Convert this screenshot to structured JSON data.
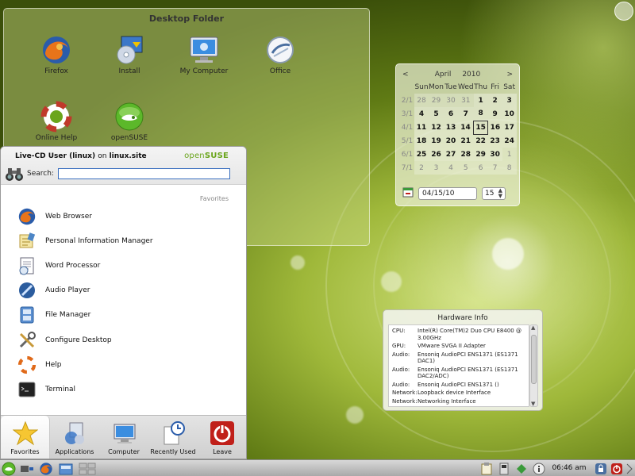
{
  "desktop_folder": {
    "title": "Desktop Folder",
    "icons": [
      {
        "label": "Firefox",
        "icon": "firefox-icon"
      },
      {
        "label": "Install",
        "icon": "install-icon"
      },
      {
        "label": "My Computer",
        "icon": "computer-icon"
      },
      {
        "label": "Office",
        "icon": "office-icon"
      },
      {
        "label": "Online Help",
        "icon": "lifebuoy-icon"
      },
      {
        "label": "openSUSE",
        "icon": "opensuse-icon"
      }
    ]
  },
  "calendar": {
    "prev": "<",
    "next": ">",
    "month": "April",
    "year": "2010",
    "weekdays": [
      "Sun",
      "Mon",
      "Tue",
      "Wed",
      "Thu",
      "Fri",
      "Sat"
    ],
    "weeks": [
      {
        "wk": "2/1",
        "days": [
          "28",
          "29",
          "30",
          "31",
          "1",
          "2",
          "3"
        ]
      },
      {
        "wk": "3/1",
        "days": [
          "4",
          "5",
          "6",
          "7",
          "8",
          "9",
          "10"
        ]
      },
      {
        "wk": "4/1",
        "days": [
          "11",
          "12",
          "13",
          "14",
          "15",
          "16",
          "17"
        ]
      },
      {
        "wk": "5/1",
        "days": [
          "18",
          "19",
          "20",
          "21",
          "22",
          "23",
          "24"
        ]
      },
      {
        "wk": "6/1",
        "days": [
          "25",
          "26",
          "27",
          "28",
          "29",
          "30",
          "1"
        ]
      },
      {
        "wk": "7/1",
        "days": [
          "2",
          "3",
          "4",
          "5",
          "6",
          "7",
          "8"
        ]
      }
    ],
    "date_value": "04/15/10",
    "week_value": "15"
  },
  "hardware_info": {
    "title": "Hardware Info",
    "rows": [
      {
        "key": "CPU:",
        "value": "Intel(R) Core(TM)2 Duo CPU E8400 @ 3.00GHz"
      },
      {
        "key": "GPU:",
        "value": "VMware SVGA II Adapter"
      },
      {
        "key": "Audio:",
        "value": "Ensoniq AudioPCI ENS1371 (ES1371 DAC1)"
      },
      {
        "key": "Audio:",
        "value": "Ensoniq AudioPCI ENS1371 (ES1371 DAC2/ADC)"
      },
      {
        "key": "Audio:",
        "value": "Ensoniq AudioPCI ENS1371 ()"
      },
      {
        "key": "Network:",
        "value": "Loopback device Interface"
      },
      {
        "key": "Network:",
        "value": "Networking Interface"
      }
    ]
  },
  "kickoff": {
    "user": "Live-CD User (linux)",
    "on": "on",
    "host": "linux.site",
    "brand_open": "open",
    "brand_suse": "SUSE",
    "search_label": "Search:",
    "search_value": "",
    "favorites_label": "Favorites",
    "items": [
      {
        "label": "Web Browser",
        "icon": "firefox-icon"
      },
      {
        "label": "Personal Information Manager",
        "icon": "pim-icon"
      },
      {
        "label": "Word Processor",
        "icon": "word-processor-icon"
      },
      {
        "label": "Audio Player",
        "icon": "audio-player-icon"
      },
      {
        "label": "File Manager",
        "icon": "file-manager-icon"
      },
      {
        "label": "Configure Desktop",
        "icon": "tools-icon"
      },
      {
        "label": "Help",
        "icon": "lifebuoy-icon"
      },
      {
        "label": "Terminal",
        "icon": "terminal-icon"
      }
    ],
    "tabs": [
      {
        "label": "Favorites",
        "icon": "star-icon"
      },
      {
        "label": "Applications",
        "icon": "applications-icon"
      },
      {
        "label": "Computer",
        "icon": "computer-icon"
      },
      {
        "label": "Recently Used",
        "icon": "clock-icon"
      },
      {
        "label": "Leave",
        "icon": "power-icon"
      }
    ]
  },
  "taskbar": {
    "clock": "06:46 am"
  },
  "colors": {
    "accent_green": "#6aa51b",
    "search_border": "#3a6fbf",
    "leave_red": "#c0201a"
  }
}
